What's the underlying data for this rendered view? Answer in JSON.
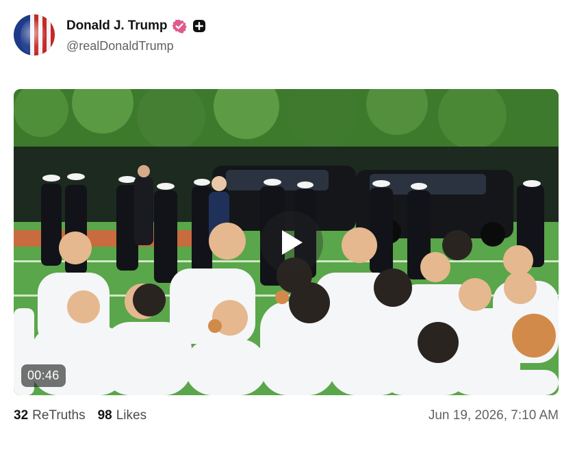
{
  "post": {
    "display_name": "Donald J. Trump",
    "handle": "@realDonaldTrump",
    "verified_icon": "verified-badge-icon",
    "verified_color": "#e05a8c",
    "plus_icon": "plus-icon",
    "video": {
      "duration": "00:46",
      "play_icon": "play-icon"
    },
    "stats": {
      "retruths_count": "32",
      "retruths_label": "ReTruths",
      "likes_count": "98",
      "likes_label": "Likes"
    },
    "timestamp": "Jun 19, 2026, 7:10 AM"
  }
}
